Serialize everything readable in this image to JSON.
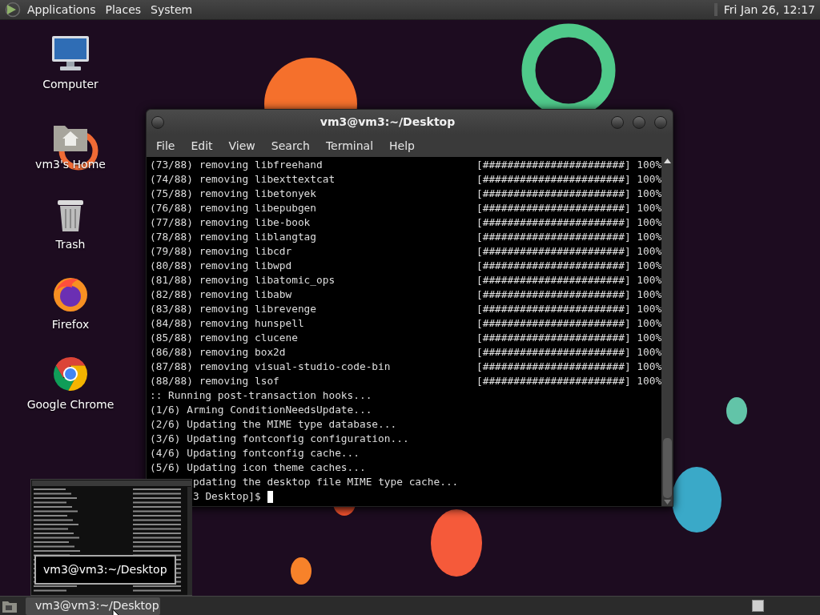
{
  "top_panel": {
    "menus": [
      "Applications",
      "Places",
      "System"
    ],
    "clock": "Fri Jan 26, 12:17"
  },
  "desktop_icons": [
    {
      "label": "Computer",
      "kind": "computer"
    },
    {
      "label": "vm3's Home",
      "kind": "home"
    },
    {
      "label": "Trash",
      "kind": "trash"
    },
    {
      "label": "Firefox",
      "kind": "firefox"
    },
    {
      "label": "Google Chrome",
      "kind": "chrome"
    }
  ],
  "terminal": {
    "title": "vm3@vm3:~/Desktop",
    "menus": [
      "File",
      "Edit",
      "View",
      "Search",
      "Terminal",
      "Help"
    ],
    "rows": [
      {
        "text": "(73/88) removing libfreehand",
        "bar": "[#######################] 100%"
      },
      {
        "text": "(74/88) removing libexttextcat",
        "bar": "[#######################] 100%"
      },
      {
        "text": "(75/88) removing libetonyek",
        "bar": "[#######################] 100%"
      },
      {
        "text": "(76/88) removing libepubgen",
        "bar": "[#######################] 100%"
      },
      {
        "text": "(77/88) removing libe-book",
        "bar": "[#######################] 100%"
      },
      {
        "text": "(78/88) removing liblangtag",
        "bar": "[#######################] 100%"
      },
      {
        "text": "(79/88) removing libcdr",
        "bar": "[#######################] 100%"
      },
      {
        "text": "(80/88) removing libwpd",
        "bar": "[#######################] 100%"
      },
      {
        "text": "(81/88) removing libatomic_ops",
        "bar": "[#######################] 100%"
      },
      {
        "text": "(82/88) removing libabw",
        "bar": "[#######################] 100%"
      },
      {
        "text": "(83/88) removing librevenge",
        "bar": "[#######################] 100%"
      },
      {
        "text": "(84/88) removing hunspell",
        "bar": "[#######################] 100%"
      },
      {
        "text": "(85/88) removing clucene",
        "bar": "[#######################] 100%"
      },
      {
        "text": "(86/88) removing box2d",
        "bar": "[#######################] 100%"
      },
      {
        "text": "(87/88) removing visual-studio-code-bin",
        "bar": "[#######################] 100%"
      },
      {
        "text": "(88/88) removing lsof",
        "bar": "[#######################] 100%"
      }
    ],
    "lines": [
      {
        "text": ":: Running post-transaction hooks...",
        "kind": "full"
      },
      {
        "text": "(1/6) Arming ConditionNeedsUpdate...",
        "kind": "full"
      },
      {
        "text": "(2/6) Updating the MIME type database...",
        "kind": "full"
      },
      {
        "text": "(3/6) Updating fontconfig configuration...",
        "kind": "full"
      },
      {
        "text": "(4/6) Updating fontconfig cache...",
        "kind": "full"
      },
      {
        "text": "(5/6) Updating icon theme caches...",
        "kind": "full"
      },
      {
        "text": "pdating the desktop file MIME type cache...",
        "kind": "partial"
      },
      {
        "text": "3 Desktop]$",
        "kind": "prompt"
      }
    ]
  },
  "preview": {
    "tooltip": "vm3@vm3:~/Desktop"
  },
  "taskbar": {
    "tasks": [
      {
        "label": "vm3@vm3:~/Desktop",
        "selected": true
      }
    ]
  }
}
